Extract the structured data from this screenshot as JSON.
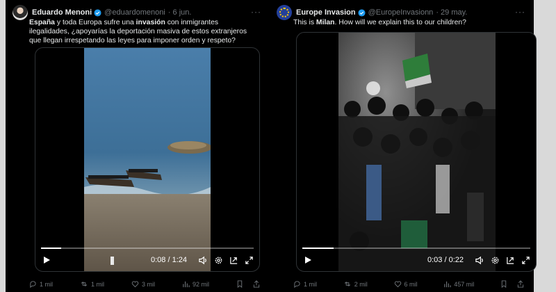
{
  "colors": {
    "background": "#d9d9d9",
    "tweet_bg": "#000000",
    "text": "#e7e9ea",
    "muted": "#71767b",
    "verified": "#1d9bf0"
  },
  "tweets": [
    {
      "author": {
        "name": "Eduardo Menoni",
        "handle": "@eduardomenoni",
        "time": "· 6 jun."
      },
      "text": {
        "p1_bold": "España",
        "p1": " y toda Europa sufre una ",
        "p2_bold": "invasión",
        "p2": " con inmigrantes ilegalidades, ¿apoyarías la deportación masiva de estos extranjeros que llegan irrespetando las leyes para imponer orden y respeto?"
      },
      "video": {
        "time": "0:08 / 1:24",
        "progress": 0.095
      },
      "stats": {
        "replies": "1 mil",
        "reposts": "1 mil",
        "likes": "3 mil",
        "views": "92 mil"
      }
    },
    {
      "author": {
        "name": "Europe Invasion",
        "handle": "@EuropeInvasionn",
        "time": "· 29 may."
      },
      "text": {
        "p1": "This is ",
        "p1_bold": "Milan",
        "p2": ". How will we explain this to our children?"
      },
      "video": {
        "time": "0:03 / 0:22",
        "progress": 0.136
      },
      "stats": {
        "replies": "1 mil",
        "reposts": "2 mil",
        "likes": "6 mil",
        "views": "457 mil"
      }
    }
  ]
}
